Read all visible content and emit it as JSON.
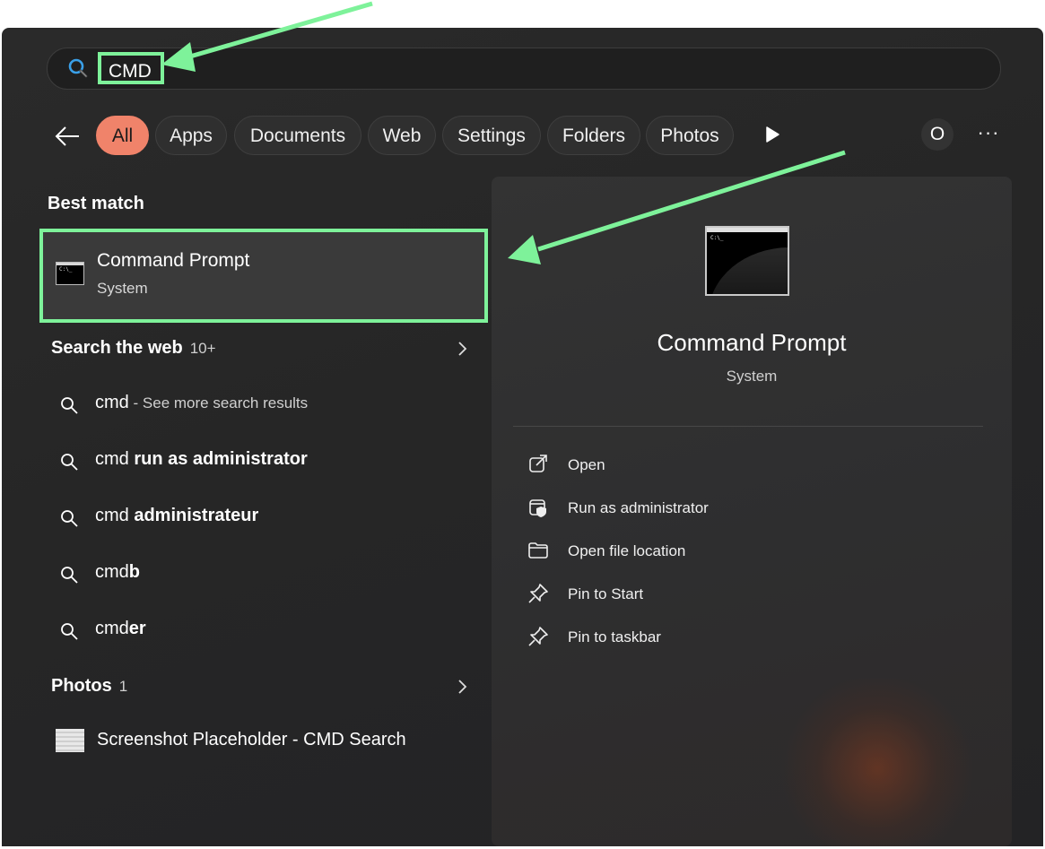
{
  "search": {
    "value": "CMD"
  },
  "filters": {
    "chips": [
      "All",
      "Apps",
      "Documents",
      "Web",
      "Settings",
      "Folders",
      "Photos"
    ],
    "active": "All",
    "profile_initial": "O",
    "more": "···"
  },
  "best_match": {
    "title": "Best match",
    "item": {
      "name": "Command Prompt",
      "category": "System"
    }
  },
  "search_web": {
    "title": "Search the web",
    "count": "10+",
    "results": [
      {
        "prefix": "cmd",
        "bold": "",
        "hint": " - See more search results"
      },
      {
        "prefix": "cmd ",
        "bold": "run as administrator",
        "hint": ""
      },
      {
        "prefix": "cmd ",
        "bold": "administrateur",
        "hint": ""
      },
      {
        "prefix": "cmd",
        "bold": "b",
        "hint": ""
      },
      {
        "prefix": "cmd",
        "bold": "er",
        "hint": ""
      }
    ]
  },
  "photos": {
    "title": "Photos",
    "count": "1",
    "item": "Screenshot Placeholder - CMD Search"
  },
  "detail": {
    "name": "Command Prompt",
    "category": "System",
    "icon_prompt": "C:\\_",
    "actions": [
      {
        "label": "Open",
        "icon": "open-external-icon"
      },
      {
        "label": "Run as administrator",
        "icon": "shield-admin-icon"
      },
      {
        "label": "Open file location",
        "icon": "folder-icon"
      },
      {
        "label": "Pin to Start",
        "icon": "pin-icon"
      },
      {
        "label": "Pin to taskbar",
        "icon": "pin-icon"
      }
    ]
  },
  "colors": {
    "highlight": "#7ef29a",
    "active_chip": "#f0836a",
    "panel": "#272727"
  }
}
